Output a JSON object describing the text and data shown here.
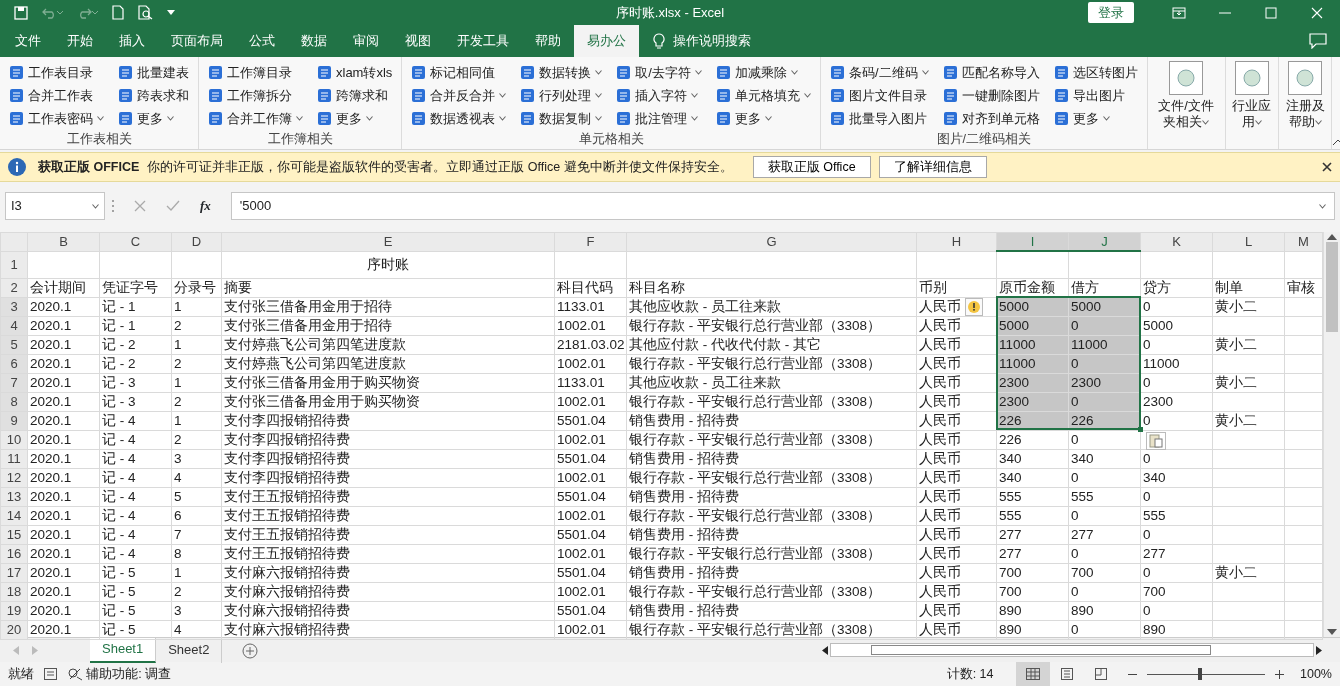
{
  "window": {
    "title": "序时账.xlsx  -  Excel",
    "login": "登录"
  },
  "quick_access": [
    {
      "kind": "save",
      "disabled": false
    },
    {
      "kind": "undo",
      "disabled": true
    },
    {
      "kind": "redo",
      "disabled": true
    },
    {
      "kind": "new",
      "disabled": false
    },
    {
      "kind": "preview",
      "disabled": false
    },
    {
      "kind": "customize",
      "disabled": false
    }
  ],
  "menu_tabs": [
    {
      "label": "文件",
      "selected": false
    },
    {
      "label": "开始",
      "selected": false
    },
    {
      "label": "插入",
      "selected": false
    },
    {
      "label": "页面布局",
      "selected": false
    },
    {
      "label": "公式",
      "selected": false
    },
    {
      "label": "数据",
      "selected": false
    },
    {
      "label": "审阅",
      "selected": false
    },
    {
      "label": "视图",
      "selected": false
    },
    {
      "label": "开发工具",
      "selected": false
    },
    {
      "label": "帮助",
      "selected": false
    },
    {
      "label": "易办公",
      "selected": true
    }
  ],
  "tell_me": "操作说明搜索",
  "ribbon_groups": [
    {
      "label": "工作表相关",
      "columns": [
        [
          {
            "label": "工作表目录",
            "dropdown": false
          },
          {
            "label": "合并工作表",
            "dropdown": false
          },
          {
            "label": "工作表密码",
            "dropdown": true
          }
        ],
        [
          {
            "label": "批量建表",
            "dropdown": false
          },
          {
            "label": "跨表求和",
            "dropdown": false
          },
          {
            "label": "更多",
            "dropdown": true
          }
        ]
      ]
    },
    {
      "label": "工作簿相关",
      "columns": [
        [
          {
            "label": "工作簿目录",
            "dropdown": false
          },
          {
            "label": "工作簿拆分",
            "dropdown": false
          },
          {
            "label": "合并工作簿",
            "dropdown": true
          }
        ],
        [
          {
            "label": "xlam转xls",
            "dropdown": false
          },
          {
            "label": "跨簿求和",
            "dropdown": false
          },
          {
            "label": "更多",
            "dropdown": true
          }
        ]
      ]
    },
    {
      "label": "单元格相关",
      "columns": [
        [
          {
            "label": "标记相同值",
            "dropdown": false
          },
          {
            "label": "合并反合并",
            "dropdown": true
          },
          {
            "label": "数据透视表",
            "dropdown": true
          }
        ],
        [
          {
            "label": "数据转换",
            "dropdown": true
          },
          {
            "label": "行列处理",
            "dropdown": true
          },
          {
            "label": "数据复制",
            "dropdown": true
          }
        ],
        [
          {
            "label": "取/去字符",
            "dropdown": true
          },
          {
            "label": "插入字符",
            "dropdown": true
          },
          {
            "label": "批注管理",
            "dropdown": true
          }
        ],
        [
          {
            "label": "加减乘除",
            "dropdown": true
          },
          {
            "label": "单元格填充",
            "dropdown": true
          },
          {
            "label": "更多",
            "dropdown": true
          }
        ]
      ]
    },
    {
      "label": "图片/二维码相关",
      "columns": [
        [
          {
            "label": "条码/二维码",
            "dropdown": true
          },
          {
            "label": "图片文件目录",
            "dropdown": false
          },
          {
            "label": "批量导入图片",
            "dropdown": false
          }
        ],
        [
          {
            "label": "匹配名称导入",
            "dropdown": false
          },
          {
            "label": "一键删除图片",
            "dropdown": false
          },
          {
            "label": "对齐到单元格",
            "dropdown": false
          }
        ],
        [
          {
            "label": "选区转图片",
            "dropdown": false
          },
          {
            "label": "导出图片",
            "dropdown": false
          },
          {
            "label": "更多",
            "dropdown": true
          }
        ]
      ]
    }
  ],
  "ribbon_large_buttons": [
    {
      "label": "文件/文件夹相关"
    },
    {
      "label": "行业应用"
    },
    {
      "label": "注册及帮助"
    }
  ],
  "message_bar": {
    "title": "获取正版 OFFICE",
    "text": "你的许可证并非正版，你可能是盗版软件的受害者。立即通过正版 Office 避免中断并使文件保持安全。",
    "buttons": [
      "获取正版 Office",
      "了解详细信息"
    ]
  },
  "formula_bar": {
    "name_box": "I3",
    "fx": "fx",
    "value": "'5000"
  },
  "columns": [
    {
      "label": "B",
      "selected": false
    },
    {
      "label": "C",
      "selected": false
    },
    {
      "label": "D",
      "selected": false
    },
    {
      "label": "E",
      "selected": false
    },
    {
      "label": "F",
      "selected": false
    },
    {
      "label": "G",
      "selected": false
    },
    {
      "label": "H",
      "selected": false
    },
    {
      "label": "I",
      "selected": true
    },
    {
      "label": "J",
      "selected": true
    },
    {
      "label": "K",
      "selected": false
    },
    {
      "label": "L",
      "selected": false
    },
    {
      "label": "M",
      "selected": false
    }
  ],
  "rows": [
    {
      "num": "1",
      "kind": "title",
      "selected": false,
      "cells": [
        null,
        null,
        null,
        "序时账",
        null,
        null,
        null,
        null,
        null,
        null,
        null,
        null
      ]
    },
    {
      "num": "2",
      "kind": "data",
      "selected": false,
      "cells": [
        "会计期间",
        "凭证字号",
        "分录号",
        "摘要",
        "科目代码",
        "科目名称",
        "币别",
        "原币金额",
        "借方",
        "贷方",
        "制单",
        "审核"
      ]
    },
    {
      "num": "3",
      "kind": "data",
      "selected": true,
      "cells": [
        "2020.1",
        "记 - 1",
        "1",
        "支付张三借备用金用于招待",
        "1133.01",
        "其他应收款 - 员工往来款",
        "人民币",
        "5000",
        "5000",
        "0",
        "黄小二",
        null
      ]
    },
    {
      "num": "4",
      "kind": "data",
      "selected": true,
      "cells": [
        "2020.1",
        "记 - 1",
        "2",
        "支付张三借备用金用于招待",
        "1002.01",
        "银行存款 - 平安银行总行营业部（3308）",
        "人民币",
        "5000",
        "0",
        "5000",
        null,
        null
      ]
    },
    {
      "num": "5",
      "kind": "data",
      "selected": true,
      "cells": [
        "2020.1",
        "记 - 2",
        "1",
        "支付婷燕飞公司第四笔进度款",
        "2181.03.02",
        "其他应付款 - 代收代付款 - 其它",
        "人民币",
        "11000",
        "11000",
        "0",
        "黄小二",
        null
      ]
    },
    {
      "num": "6",
      "kind": "data",
      "selected": true,
      "cells": [
        "2020.1",
        "记 - 2",
        "2",
        "支付婷燕飞公司第四笔进度款",
        "1002.01",
        "银行存款 - 平安银行总行营业部（3308）",
        "人民币",
        "11000",
        "0",
        "11000",
        null,
        null
      ]
    },
    {
      "num": "7",
      "kind": "data",
      "selected": true,
      "cells": [
        "2020.1",
        "记 - 3",
        "1",
        "支付张三借备用金用于购买物资",
        "1133.01",
        "其他应收款 - 员工往来款",
        "人民币",
        "2300",
        "2300",
        "0",
        "黄小二",
        null
      ]
    },
    {
      "num": "8",
      "kind": "data",
      "selected": true,
      "cells": [
        "2020.1",
        "记 - 3",
        "2",
        "支付张三借备用金用于购买物资",
        "1002.01",
        "银行存款 - 平安银行总行营业部（3308）",
        "人民币",
        "2300",
        "0",
        "2300",
        null,
        null
      ]
    },
    {
      "num": "9",
      "kind": "data",
      "selected": true,
      "cells": [
        "2020.1",
        "记 - 4",
        "1",
        "支付李四报销招待费",
        "5501.04",
        "销售费用 - 招待费",
        "人民币",
        "226",
        "226",
        "0",
        "黄小二",
        null
      ]
    },
    {
      "num": "10",
      "kind": "data",
      "selected": false,
      "cells": [
        "2020.1",
        "记 - 4",
        "2",
        "支付李四报销招待费",
        "1002.01",
        "银行存款 - 平安银行总行营业部（3308）",
        "人民币",
        "226",
        "0",
        null,
        null,
        null
      ]
    },
    {
      "num": "11",
      "kind": "data",
      "selected": false,
      "cells": [
        "2020.1",
        "记 - 4",
        "3",
        "支付李四报销招待费",
        "5501.04",
        "销售费用 - 招待费",
        "人民币",
        "340",
        "340",
        "0",
        null,
        null
      ]
    },
    {
      "num": "12",
      "kind": "data",
      "selected": false,
      "cells": [
        "2020.1",
        "记 - 4",
        "4",
        "支付李四报销招待费",
        "1002.01",
        "银行存款 - 平安银行总行营业部（3308）",
        "人民币",
        "340",
        "0",
        "340",
        null,
        null
      ]
    },
    {
      "num": "13",
      "kind": "data",
      "selected": false,
      "cells": [
        "2020.1",
        "记 - 4",
        "5",
        "支付王五报销招待费",
        "5501.04",
        "销售费用 - 招待费",
        "人民币",
        "555",
        "555",
        "0",
        null,
        null
      ]
    },
    {
      "num": "14",
      "kind": "data",
      "selected": false,
      "cells": [
        "2020.1",
        "记 - 4",
        "6",
        "支付王五报销招待费",
        "1002.01",
        "银行存款 - 平安银行总行营业部（3308）",
        "人民币",
        "555",
        "0",
        "555",
        null,
        null
      ]
    },
    {
      "num": "15",
      "kind": "data",
      "selected": false,
      "cells": [
        "2020.1",
        "记 - 4",
        "7",
        "支付王五报销招待费",
        "5501.04",
        "销售费用 - 招待费",
        "人民币",
        "277",
        "277",
        "0",
        null,
        null
      ]
    },
    {
      "num": "16",
      "kind": "data",
      "selected": false,
      "cells": [
        "2020.1",
        "记 - 4",
        "8",
        "支付王五报销招待费",
        "1002.01",
        "银行存款 - 平安银行总行营业部（3308）",
        "人民币",
        "277",
        "0",
        "277",
        null,
        null
      ]
    },
    {
      "num": "17",
      "kind": "data",
      "selected": false,
      "cells": [
        "2020.1",
        "记 - 5",
        "1",
        "支付麻六报销招待费",
        "5501.04",
        "销售费用 - 招待费",
        "人民币",
        "700",
        "700",
        "0",
        "黄小二",
        null
      ]
    },
    {
      "num": "18",
      "kind": "data",
      "selected": false,
      "cells": [
        "2020.1",
        "记 - 5",
        "2",
        "支付麻六报销招待费",
        "1002.01",
        "银行存款 - 平安银行总行营业部（3308）",
        "人民币",
        "700",
        "0",
        "700",
        null,
        null
      ]
    },
    {
      "num": "19",
      "kind": "data",
      "selected": false,
      "cells": [
        "2020.1",
        "记 - 5",
        "3",
        "支付麻六报销招待费",
        "5501.04",
        "销售费用 - 招待费",
        "人民币",
        "890",
        "890",
        "0",
        null,
        null
      ]
    },
    {
      "num": "20",
      "kind": "data",
      "selected": false,
      "cells": [
        "2020.1",
        "记 - 5",
        "4",
        "支付麻六报销招待费",
        "1002.01",
        "银行存款 - 平安银行总行营业部（3308）",
        "人民币",
        "890",
        "0",
        "890",
        null,
        null
      ]
    }
  ],
  "sheet_tabs": [
    {
      "label": "Sheet1",
      "selected": true
    },
    {
      "label": "Sheet2",
      "selected": false
    }
  ],
  "status_bar": {
    "ready": "就绪",
    "accessibility": "辅助功能: 调查",
    "count": "计数: 14",
    "views": [
      {
        "kind": "normal",
        "selected": true
      },
      {
        "kind": "page_layout",
        "selected": false
      },
      {
        "kind": "page_break",
        "selected": false
      }
    ],
    "zoom": {
      "level": 0.45
    },
    "zoom_text": "100%"
  }
}
